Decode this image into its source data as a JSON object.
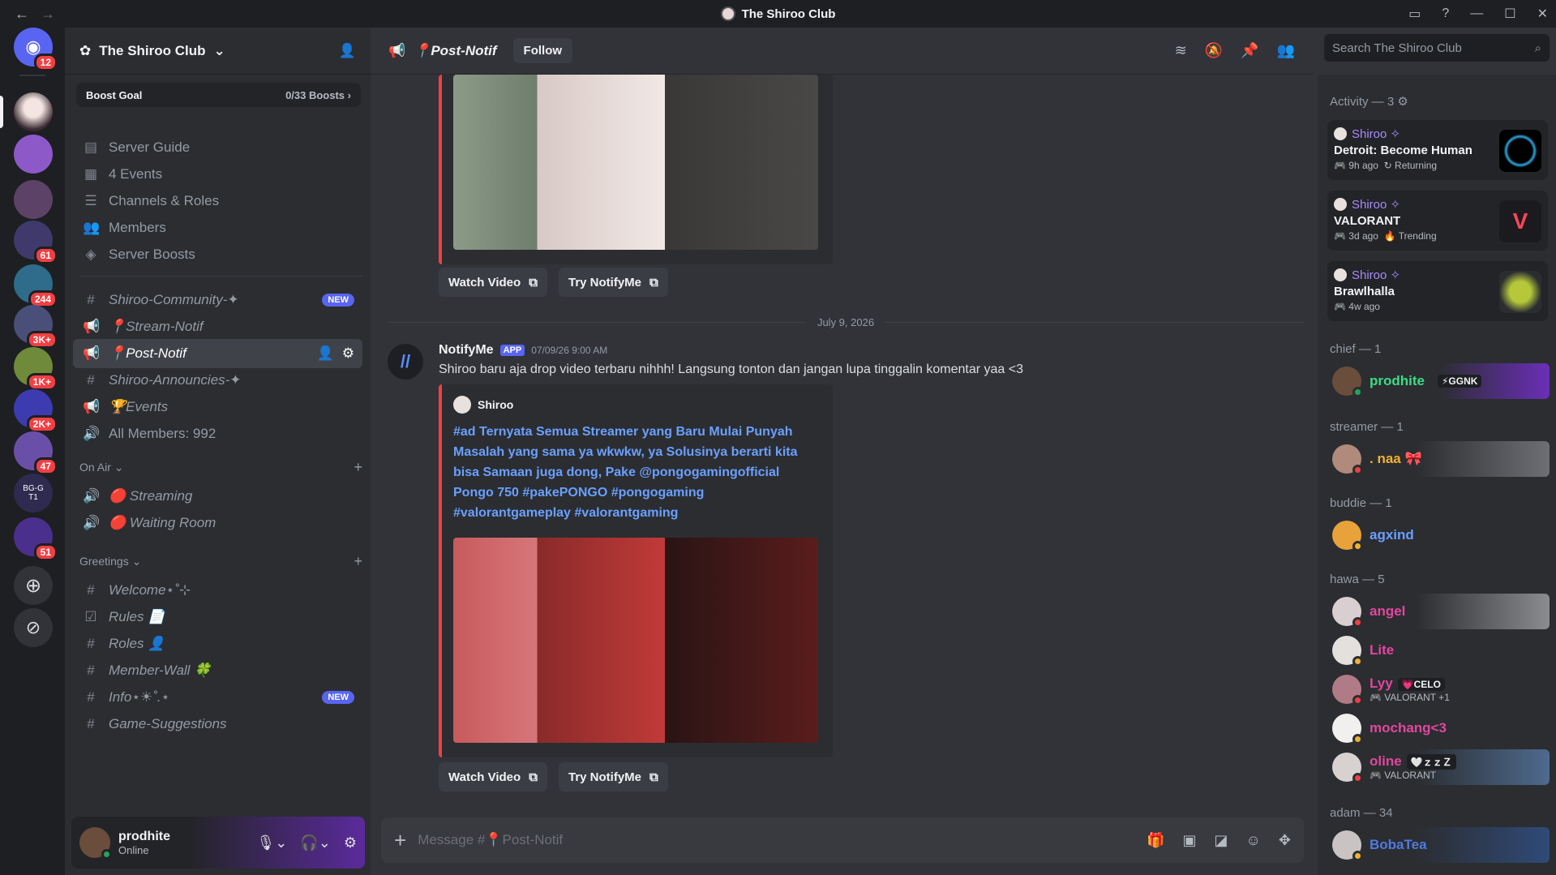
{
  "window": {
    "title": "The Shiroo Club"
  },
  "guilds": {
    "home_badge": "12",
    "badges": [
      "61",
      "244",
      "3K+",
      "1K+",
      "2K+",
      "47",
      "51"
    ],
    "tagged": "BG-G",
    "tagged2": "T1"
  },
  "server": {
    "name": "The Shiroo Club",
    "boost_label": "Boost Goal",
    "boost_count": "0/33 Boosts"
  },
  "nav": [
    {
      "label": "Server Guide"
    },
    {
      "label": "4 Events"
    },
    {
      "label": "Channels & Roles"
    },
    {
      "label": "Members"
    },
    {
      "label": "Server Boosts"
    }
  ],
  "channels": [
    {
      "label": "Shiroo-Community-✦",
      "badge": "NEW"
    },
    {
      "label": "📍Stream-Notif"
    },
    {
      "label": "📍Post-Notif"
    },
    {
      "label": "Shiroo-Announcies-✦"
    },
    {
      "label": "🏆Events"
    },
    {
      "label": "All Members: 992"
    }
  ],
  "categories": {
    "on_air": "On Air",
    "greetings": "Greetings"
  },
  "onair": [
    {
      "label": "🔴 Streaming"
    },
    {
      "label": "🔴 Waiting Room"
    }
  ],
  "greetings": [
    {
      "label": "Welcome⋆˚⊹"
    },
    {
      "label": "Rules 📄"
    },
    {
      "label": "Roles 👤"
    },
    {
      "label": "Member-Wall 🍀"
    },
    {
      "label": "Info⋆☀︎˚.⋆",
      "badge": "NEW"
    },
    {
      "label": "Game-Suggestions"
    }
  ],
  "user": {
    "name": "prodhite",
    "status": "Online"
  },
  "header": {
    "channel": "📍Post-Notif",
    "follow": "Follow",
    "search_placeholder": "Search The Shiroo Club"
  },
  "buttons": {
    "watch": "Watch Video",
    "try": "Try NotifyMe"
  },
  "date_separator": "July 9, 2026",
  "message": {
    "author": "NotifyMe",
    "app_tag": "APP",
    "timestamp": "07/09/26 9:00 AM",
    "text": "Shiroo baru aja drop video terbaru nihhh! Langsung tonton dan jangan lupa tinggalin komentar yaa <3",
    "embed_author": "Shiroo",
    "embed_title": "#ad Ternyata Semua Streamer yang Baru Mulai Punyah Masalah yang sama ya wkwkw, ya Solusinya berarti kita bisa Samaan juga dong, Pake @pongogamingofficial Pongo 750  #pakePONGO #pongogaming #valorantgameplay #valorantgaming"
  },
  "composer": {
    "placeholder": "Message #📍Post-Notif"
  },
  "activity": {
    "header": "Activity — 3",
    "items": [
      {
        "who": "Shiroo ✧",
        "game": "Detroit: Become Human",
        "time": "9h ago",
        "tag": "Returning"
      },
      {
        "who": "Shiroo ✧",
        "game": "VALORANT",
        "time": "3d ago",
        "tag": "Trending"
      },
      {
        "who": "Shiroo ✧",
        "game": "Brawlhalla",
        "time": "4w ago"
      }
    ]
  },
  "roles": [
    {
      "header": "chief — 1",
      "members": [
        {
          "name": "prodhite",
          "tag": "⚡GGNK"
        }
      ]
    },
    {
      "header": "streamer — 1",
      "members": [
        {
          "name": ". naa 🎀"
        }
      ]
    },
    {
      "header": "buddie — 1",
      "members": [
        {
          "name": "agxind"
        }
      ]
    },
    {
      "header": "hawa — 5",
      "members": [
        {
          "name": "angel"
        },
        {
          "name": "Lite"
        },
        {
          "name": "Lyy",
          "tag": "💗CELO",
          "sub": "🎮 VALORANT +1"
        },
        {
          "name": "mochang<3"
        },
        {
          "name": "oline",
          "tag": "🤍ｚｚＺ",
          "sub": "🎮 VALORANT"
        }
      ]
    },
    {
      "header": "adam — 34",
      "members": [
        {
          "name": "BobaTea"
        }
      ]
    }
  ]
}
